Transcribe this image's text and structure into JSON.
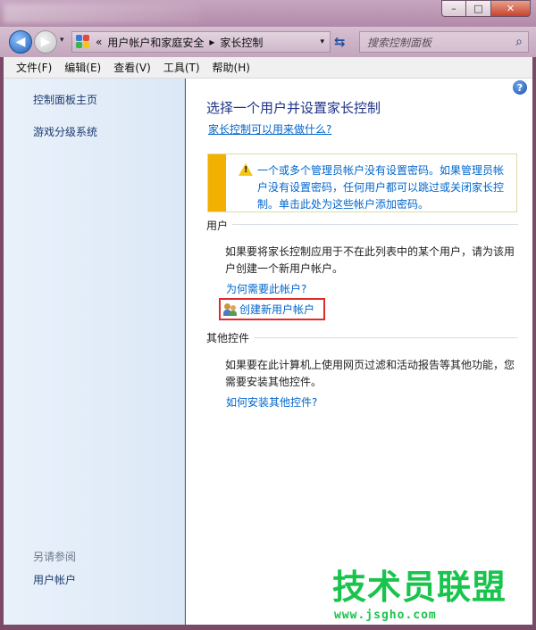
{
  "window": {
    "minimize": "–",
    "maximize": "□",
    "close": "✕"
  },
  "nav": {
    "back": "◀",
    "forward": "▶",
    "dropdown": "▾",
    "breadcrumb_prefix": "«",
    "breadcrumb": [
      "用户帐户和家庭安全",
      "家长控制"
    ],
    "breadcrumb_sep": "▸",
    "address_dropdown": "▾",
    "refresh": "⇆",
    "search_placeholder": "搜索控制面板",
    "search_icon": "⌕"
  },
  "menu": [
    "文件(F)",
    "编辑(E)",
    "查看(V)",
    "工具(T)",
    "帮助(H)"
  ],
  "sidebar": {
    "home": "控制面板主页",
    "games": "游戏分级系统",
    "see_also": "另请参阅",
    "users": "用户帐户"
  },
  "main": {
    "help": "?",
    "title": "选择一个用户并设置家长控制",
    "what_link": "家长控制可以用来做什么?",
    "warning": "一个或多个管理员帐户没有设置密码。如果管理员帐户没有设置密码，任何用户都可以跳过或关闭家长控制。单击此处为这些帐户添加密码。",
    "users_head": "用户",
    "users_text": "如果要将家长控制应用于不在此列表中的某个用户，请为该用户创建一个新用户帐户。",
    "why_link": "为何需要此帐户?",
    "create_link": "创建新用户帐户",
    "other_head": "其他控件",
    "other_text": "如果要在此计算机上使用网页过滤和活动报告等其他功能，您需要安装其他控件。",
    "install_link": "如何安装其他控件?"
  },
  "watermark": {
    "title": "技术员联盟",
    "url": "www.jsgho.com"
  },
  "colors": {
    "link": "#0066cc",
    "title": "#1e3287",
    "warning_bar": "#f2b100",
    "highlight": "#e02b2b",
    "watermark": "#19c44c"
  }
}
